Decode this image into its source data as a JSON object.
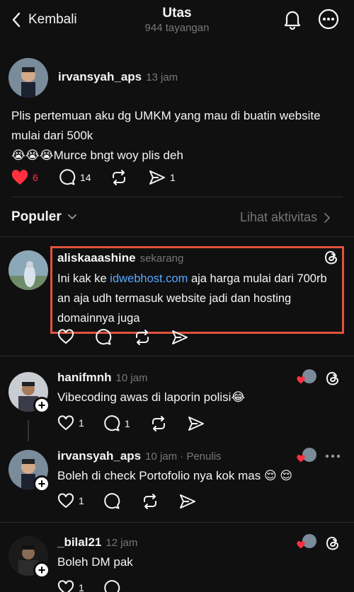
{
  "header": {
    "back_label": "Kembali",
    "title": "Utas",
    "subtitle": "944 tayangan"
  },
  "main_post": {
    "username": "irvansyah_aps",
    "time": "13 jam",
    "text_line1": "Plis pertemuan aku dg UMKM yang mau di buatin website",
    "text_line2": "mulai dari 500k",
    "emojis": "😭😭😭",
    "text_line3": "Murce bngt woy plis deh",
    "likes": "6",
    "replies": "14",
    "shares": "1"
  },
  "sort_bar": {
    "label": "Populer",
    "activity_label": "Lihat aktivitas"
  },
  "replies": [
    {
      "username": "aliskaaashine",
      "time": "sekarang",
      "text_prefix": "Ini kak ke ",
      "link": "idwebhost.com",
      "text_suffix": " aja harga mulai dari 700rb",
      "line2": "an aja udh termasuk website jadi dan hosting",
      "line3": "domainnya juga"
    },
    {
      "username": "hanifmnh",
      "time": "10 jam",
      "text": "Vibecoding awas di laporin polisi😂",
      "likes": "1",
      "replies": "1"
    },
    {
      "username": "irvansyah_aps",
      "time": "10 jam",
      "author_tag": "· Penulis",
      "text": "Boleh di check Portofolio nya kok mas 😌 😌",
      "likes": "1"
    },
    {
      "username": "_bilal21",
      "time": "12 jam",
      "text": "Boleh DM pak",
      "likes": "1"
    }
  ],
  "colors": {
    "background": "#101010",
    "highlight_border": "#e0533d",
    "like_red": "#ff3040",
    "link_blue": "#5aa7ff"
  }
}
